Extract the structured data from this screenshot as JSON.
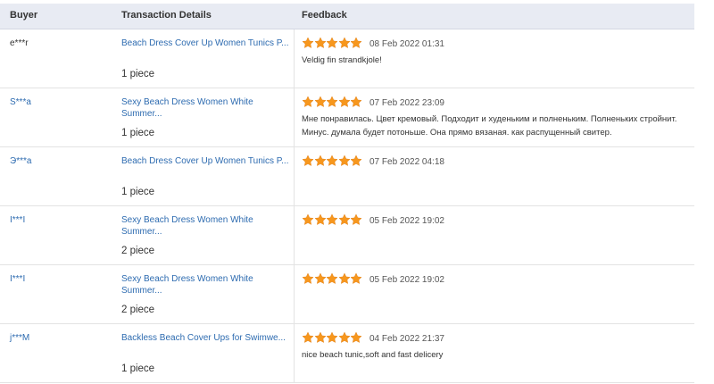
{
  "header": {
    "buyer": "Buyer",
    "details": "Transaction Details",
    "feedback": "Feedback"
  },
  "rating_color": "#f7971d",
  "rows": [
    {
      "buyer": "e***r",
      "product": "Beach Dress Cover Up Women Tunics P...",
      "quantity": "1 piece",
      "stars": 5,
      "date": "08 Feb 2022 01:31",
      "comment": "Veldig fin strandkjole!"
    },
    {
      "buyer": "S***a",
      "product": "Sexy Beach Dress Women White Summer...",
      "quantity": "1 piece",
      "stars": 5,
      "date": "07 Feb 2022 23:09",
      "comment": "Мне понравилась. Цвет кремовый. Подходит и худеньким и полненьким. Полненьких стройнит. Минус. думала будет потоньше. Она прямо вязаная. как распущенный свитер."
    },
    {
      "buyer": "Э***а",
      "product": "Beach Dress Cover Up Women Tunics P...",
      "quantity": "1 piece",
      "stars": 5,
      "date": "07 Feb 2022 04:18",
      "comment": ""
    },
    {
      "buyer": "I***I",
      "product": "Sexy Beach Dress Women White Summer...",
      "quantity": "2 piece",
      "stars": 5,
      "date": "05 Feb 2022 19:02",
      "comment": ""
    },
    {
      "buyer": "I***I",
      "product": "Sexy Beach Dress Women White Summer...",
      "quantity": "2 piece",
      "stars": 5,
      "date": "05 Feb 2022 19:02",
      "comment": ""
    },
    {
      "buyer": "j***M",
      "product": "Backless Beach Cover Ups for Swimwe...",
      "quantity": "1 piece",
      "stars": 5,
      "date": "04 Feb 2022 21:37",
      "comment": "nice beach tunic,soft and fast delicery"
    }
  ]
}
